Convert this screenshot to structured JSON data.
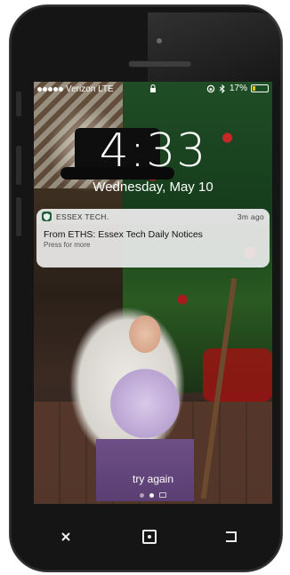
{
  "status_bar": {
    "carrier": "Verizon LTE",
    "battery_percent": "17%",
    "battery_level": 0.17
  },
  "lock_screen": {
    "time": "4:33",
    "date": "Wednesday, May 10",
    "unlock_hint": "try again"
  },
  "notification": {
    "app_name": "ESSEX TECH.",
    "time_ago": "3m ago",
    "title": "From ETHS: Essex Tech Daily Notices",
    "subtitle": "Press for more",
    "icon": "shield-app-icon"
  },
  "page_indicator": {
    "page_count": 2,
    "active_page": 2
  },
  "nav": {
    "close_icon": "close-icon",
    "home_icon": "home-square-icon",
    "back_icon": "back-icon"
  },
  "colors": {
    "battery_fill": "#f1c40f",
    "app_icon_bg": "#1f5f3a",
    "phone_body": "#151515"
  }
}
